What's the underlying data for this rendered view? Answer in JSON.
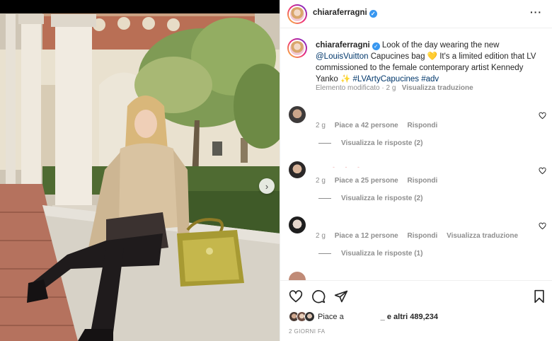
{
  "post": {
    "username": "chiaraferragni",
    "more_icon": "more-horizontal-icon",
    "caption": {
      "username": "chiaraferragni",
      "text_1": "Look of the day wearing the new",
      "mention": "@LouisVuitton",
      "text_2": "Capucines bag",
      "emoji_heart": "💛",
      "text_3": "It's a limited edition that LV commissioned to the female contemporary artist Kennedy Yanko",
      "emoji_sparkles": "✨",
      "hashtag_1": "#LVArtyCapucines",
      "hashtag_2": "#adv",
      "edited_label": "Elemento modificato",
      "time": "2 g",
      "translate_label": "Visualizza traduzione"
    },
    "comments": [
      {
        "time": "2 g",
        "likes": "Piace a 42 persone",
        "reply": "Rispondi",
        "translate": "",
        "view_replies": "Visualizza le risposte (2)"
      },
      {
        "time": "2 g",
        "likes": "Piace a 25 persone",
        "reply": "Rispondi",
        "translate": "",
        "view_replies": "Visualizza le risposte (2)"
      },
      {
        "time": "2 g",
        "likes": "Piace a 12 persone",
        "reply": "Rispondi",
        "translate": "Visualizza traduzione",
        "view_replies": "Visualizza le risposte (1)"
      }
    ],
    "likes_summary": {
      "prefix": "Piace a",
      "suffix": "_ e altri",
      "count": "489,234"
    },
    "date": "2 GIORNI FA",
    "colors": {
      "link": "#00376b",
      "muted": "#8e8e8e",
      "verified": "#3897f0"
    }
  }
}
